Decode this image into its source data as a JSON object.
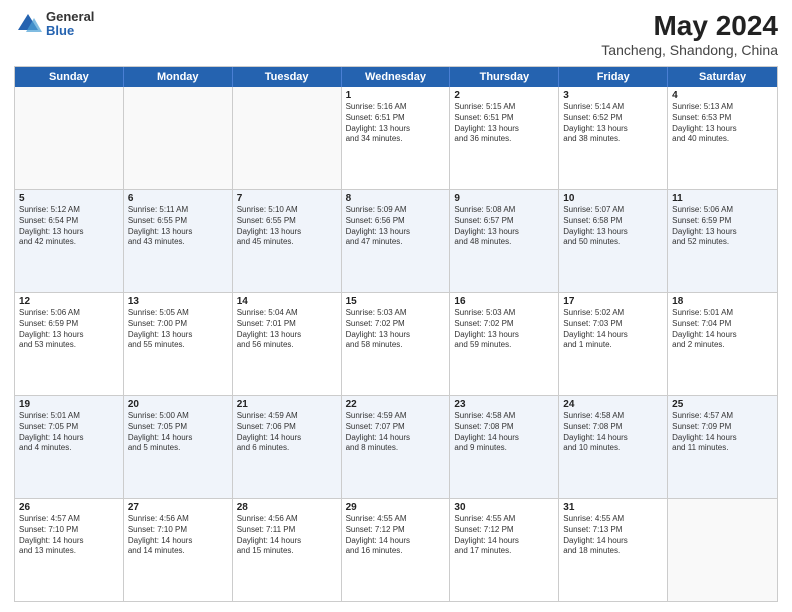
{
  "logo": {
    "general": "General",
    "blue": "Blue"
  },
  "title": "May 2024",
  "subtitle": "Tancheng, Shandong, China",
  "days_of_week": [
    "Sunday",
    "Monday",
    "Tuesday",
    "Wednesday",
    "Thursday",
    "Friday",
    "Saturday"
  ],
  "weeks": [
    [
      {
        "day": "",
        "lines": []
      },
      {
        "day": "",
        "lines": []
      },
      {
        "day": "",
        "lines": []
      },
      {
        "day": "1",
        "lines": [
          "Sunrise: 5:16 AM",
          "Sunset: 6:51 PM",
          "Daylight: 13 hours",
          "and 34 minutes."
        ]
      },
      {
        "day": "2",
        "lines": [
          "Sunrise: 5:15 AM",
          "Sunset: 6:51 PM",
          "Daylight: 13 hours",
          "and 36 minutes."
        ]
      },
      {
        "day": "3",
        "lines": [
          "Sunrise: 5:14 AM",
          "Sunset: 6:52 PM",
          "Daylight: 13 hours",
          "and 38 minutes."
        ]
      },
      {
        "day": "4",
        "lines": [
          "Sunrise: 5:13 AM",
          "Sunset: 6:53 PM",
          "Daylight: 13 hours",
          "and 40 minutes."
        ]
      }
    ],
    [
      {
        "day": "5",
        "lines": [
          "Sunrise: 5:12 AM",
          "Sunset: 6:54 PM",
          "Daylight: 13 hours",
          "and 42 minutes."
        ]
      },
      {
        "day": "6",
        "lines": [
          "Sunrise: 5:11 AM",
          "Sunset: 6:55 PM",
          "Daylight: 13 hours",
          "and 43 minutes."
        ]
      },
      {
        "day": "7",
        "lines": [
          "Sunrise: 5:10 AM",
          "Sunset: 6:55 PM",
          "Daylight: 13 hours",
          "and 45 minutes."
        ]
      },
      {
        "day": "8",
        "lines": [
          "Sunrise: 5:09 AM",
          "Sunset: 6:56 PM",
          "Daylight: 13 hours",
          "and 47 minutes."
        ]
      },
      {
        "day": "9",
        "lines": [
          "Sunrise: 5:08 AM",
          "Sunset: 6:57 PM",
          "Daylight: 13 hours",
          "and 48 minutes."
        ]
      },
      {
        "day": "10",
        "lines": [
          "Sunrise: 5:07 AM",
          "Sunset: 6:58 PM",
          "Daylight: 13 hours",
          "and 50 minutes."
        ]
      },
      {
        "day": "11",
        "lines": [
          "Sunrise: 5:06 AM",
          "Sunset: 6:59 PM",
          "Daylight: 13 hours",
          "and 52 minutes."
        ]
      }
    ],
    [
      {
        "day": "12",
        "lines": [
          "Sunrise: 5:06 AM",
          "Sunset: 6:59 PM",
          "Daylight: 13 hours",
          "and 53 minutes."
        ]
      },
      {
        "day": "13",
        "lines": [
          "Sunrise: 5:05 AM",
          "Sunset: 7:00 PM",
          "Daylight: 13 hours",
          "and 55 minutes."
        ]
      },
      {
        "day": "14",
        "lines": [
          "Sunrise: 5:04 AM",
          "Sunset: 7:01 PM",
          "Daylight: 13 hours",
          "and 56 minutes."
        ]
      },
      {
        "day": "15",
        "lines": [
          "Sunrise: 5:03 AM",
          "Sunset: 7:02 PM",
          "Daylight: 13 hours",
          "and 58 minutes."
        ]
      },
      {
        "day": "16",
        "lines": [
          "Sunrise: 5:03 AM",
          "Sunset: 7:02 PM",
          "Daylight: 13 hours",
          "and 59 minutes."
        ]
      },
      {
        "day": "17",
        "lines": [
          "Sunrise: 5:02 AM",
          "Sunset: 7:03 PM",
          "Daylight: 14 hours",
          "and 1 minute."
        ]
      },
      {
        "day": "18",
        "lines": [
          "Sunrise: 5:01 AM",
          "Sunset: 7:04 PM",
          "Daylight: 14 hours",
          "and 2 minutes."
        ]
      }
    ],
    [
      {
        "day": "19",
        "lines": [
          "Sunrise: 5:01 AM",
          "Sunset: 7:05 PM",
          "Daylight: 14 hours",
          "and 4 minutes."
        ]
      },
      {
        "day": "20",
        "lines": [
          "Sunrise: 5:00 AM",
          "Sunset: 7:05 PM",
          "Daylight: 14 hours",
          "and 5 minutes."
        ]
      },
      {
        "day": "21",
        "lines": [
          "Sunrise: 4:59 AM",
          "Sunset: 7:06 PM",
          "Daylight: 14 hours",
          "and 6 minutes."
        ]
      },
      {
        "day": "22",
        "lines": [
          "Sunrise: 4:59 AM",
          "Sunset: 7:07 PM",
          "Daylight: 14 hours",
          "and 8 minutes."
        ]
      },
      {
        "day": "23",
        "lines": [
          "Sunrise: 4:58 AM",
          "Sunset: 7:08 PM",
          "Daylight: 14 hours",
          "and 9 minutes."
        ]
      },
      {
        "day": "24",
        "lines": [
          "Sunrise: 4:58 AM",
          "Sunset: 7:08 PM",
          "Daylight: 14 hours",
          "and 10 minutes."
        ]
      },
      {
        "day": "25",
        "lines": [
          "Sunrise: 4:57 AM",
          "Sunset: 7:09 PM",
          "Daylight: 14 hours",
          "and 11 minutes."
        ]
      }
    ],
    [
      {
        "day": "26",
        "lines": [
          "Sunrise: 4:57 AM",
          "Sunset: 7:10 PM",
          "Daylight: 14 hours",
          "and 13 minutes."
        ]
      },
      {
        "day": "27",
        "lines": [
          "Sunrise: 4:56 AM",
          "Sunset: 7:10 PM",
          "Daylight: 14 hours",
          "and 14 minutes."
        ]
      },
      {
        "day": "28",
        "lines": [
          "Sunrise: 4:56 AM",
          "Sunset: 7:11 PM",
          "Daylight: 14 hours",
          "and 15 minutes."
        ]
      },
      {
        "day": "29",
        "lines": [
          "Sunrise: 4:55 AM",
          "Sunset: 7:12 PM",
          "Daylight: 14 hours",
          "and 16 minutes."
        ]
      },
      {
        "day": "30",
        "lines": [
          "Sunrise: 4:55 AM",
          "Sunset: 7:12 PM",
          "Daylight: 14 hours",
          "and 17 minutes."
        ]
      },
      {
        "day": "31",
        "lines": [
          "Sunrise: 4:55 AM",
          "Sunset: 7:13 PM",
          "Daylight: 14 hours",
          "and 18 minutes."
        ]
      },
      {
        "day": "",
        "lines": []
      }
    ]
  ]
}
